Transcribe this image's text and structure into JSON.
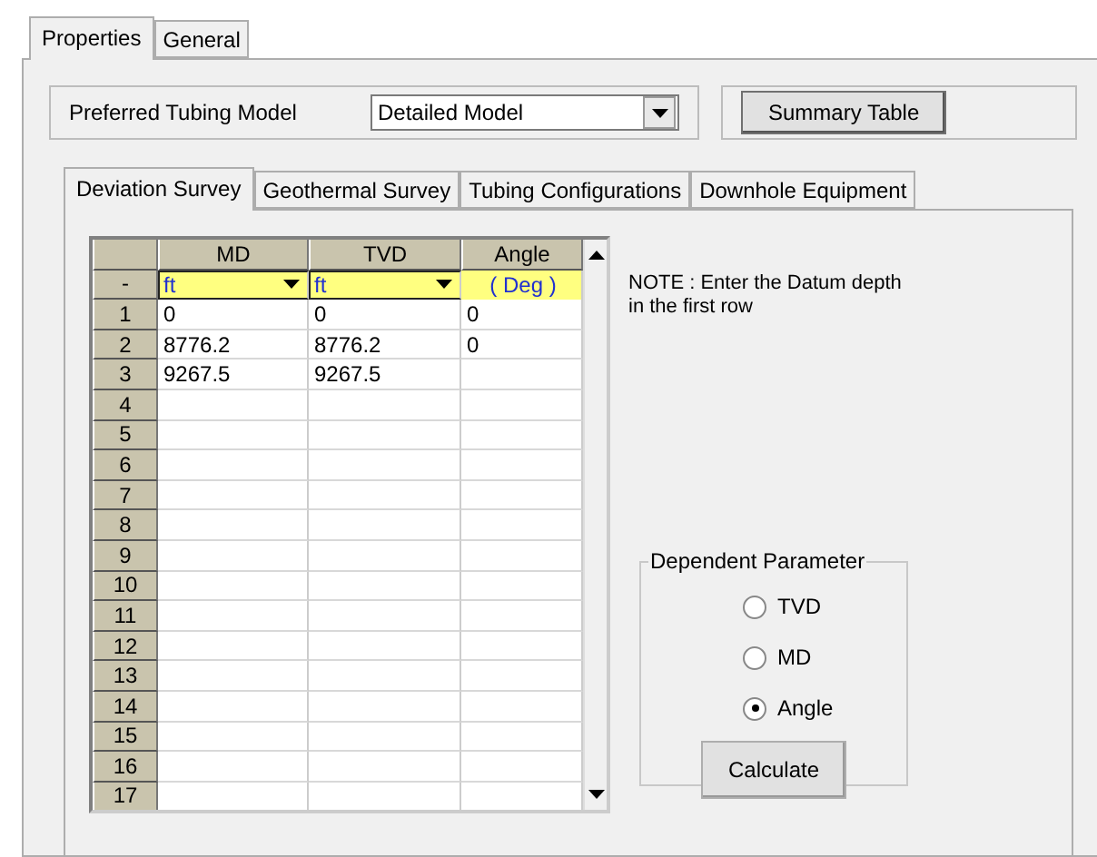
{
  "outer_tabs": [
    {
      "label": "Properties",
      "selected": true
    },
    {
      "label": "General",
      "selected": false
    }
  ],
  "tubing_model": {
    "label": "Preferred Tubing Model",
    "value": "Detailed Model"
  },
  "summary_button": "Summary Table",
  "inner_tabs": [
    {
      "label": "Deviation Survey",
      "selected": true
    },
    {
      "label": "Geothermal Survey",
      "selected": false
    },
    {
      "label": "Tubing Configurations",
      "selected": false
    },
    {
      "label": "Downhole Equipment",
      "selected": false
    }
  ],
  "grid": {
    "corner": "-",
    "columns": [
      "MD",
      "TVD",
      "Angle"
    ],
    "units": [
      {
        "kind": "dropdown",
        "value": "ft"
      },
      {
        "kind": "dropdown",
        "value": "ft"
      },
      {
        "kind": "label",
        "value": "( Deg )"
      }
    ],
    "rows": [
      {
        "number": "1",
        "cells": [
          "0",
          "0",
          "0"
        ]
      },
      {
        "number": "2",
        "cells": [
          "8776.2",
          "8776.2",
          "0"
        ]
      },
      {
        "number": "3",
        "cells": [
          "9267.5",
          "9267.5"
        ]
      },
      {
        "number": "4"
      },
      {
        "number": "5"
      },
      {
        "number": "6"
      },
      {
        "number": "7"
      },
      {
        "number": "8"
      },
      {
        "number": "9"
      },
      {
        "number": "10"
      },
      {
        "number": "11"
      },
      {
        "number": "12"
      },
      {
        "number": "13"
      },
      {
        "number": "14"
      },
      {
        "number": "15"
      },
      {
        "number": "16"
      },
      {
        "number": "17"
      }
    ]
  },
  "note": "NOTE : Enter the Datum depth in the first row",
  "dependent_parameter": {
    "title": "Dependent Parameter",
    "options": [
      {
        "label": "TVD",
        "selected": false
      },
      {
        "label": "MD",
        "selected": false
      },
      {
        "label": "Angle",
        "selected": true
      }
    ],
    "button": "Calculate"
  }
}
